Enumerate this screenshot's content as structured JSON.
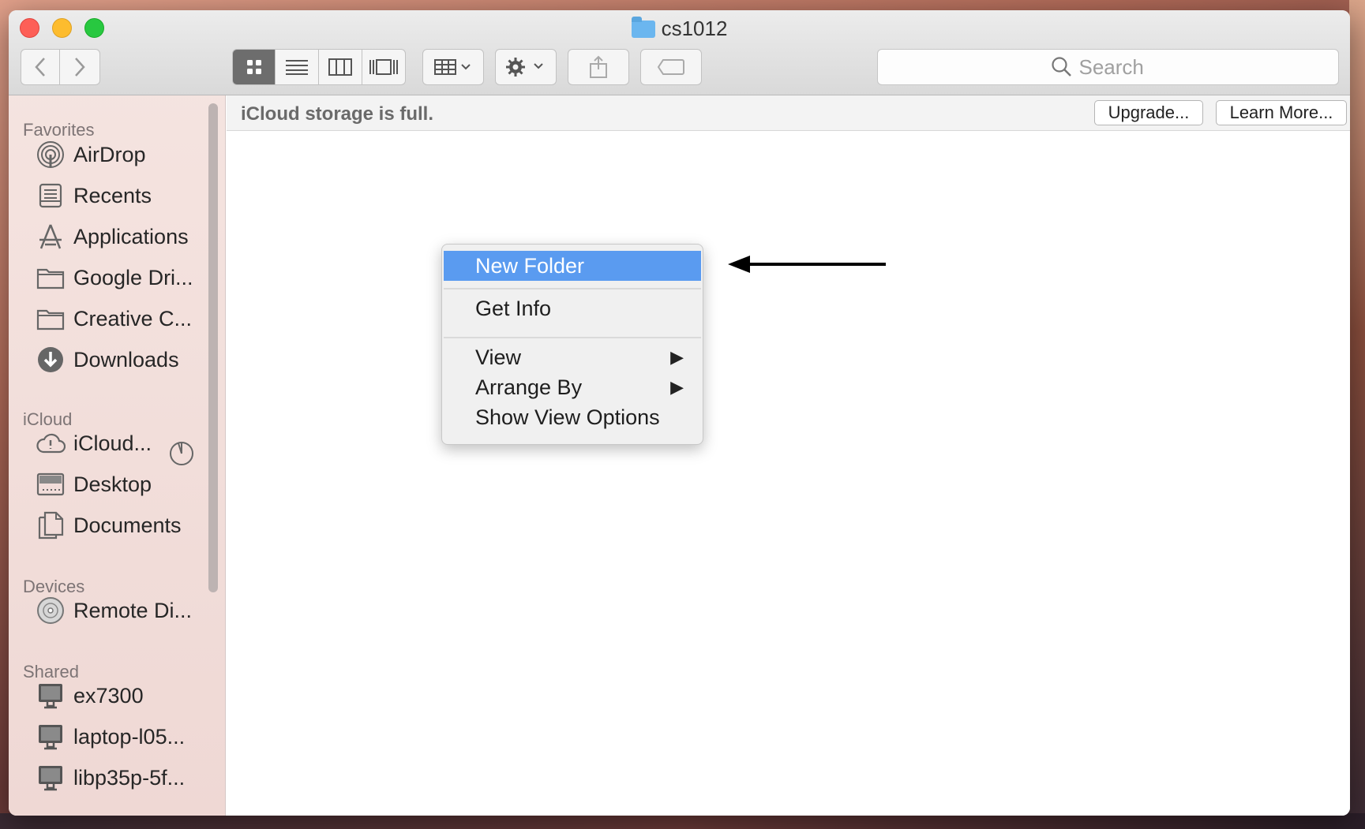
{
  "window": {
    "title": "cs1012"
  },
  "toolbar": {
    "search_placeholder": "Search"
  },
  "banner": {
    "message": "iCloud storage is full.",
    "upgrade_label": "Upgrade...",
    "learn_more_label": "Learn More..."
  },
  "sidebar": {
    "favorites_heading": "Favorites",
    "favorites": [
      {
        "label": "AirDrop",
        "icon": "airdrop-icon"
      },
      {
        "label": "Recents",
        "icon": "recents-icon"
      },
      {
        "label": "Applications",
        "icon": "applications-icon"
      },
      {
        "label": "Google Dri...",
        "icon": "folder-icon"
      },
      {
        "label": "Creative C...",
        "icon": "folder-icon"
      },
      {
        "label": "Downloads",
        "icon": "downloads-icon"
      }
    ],
    "icloud_heading": "iCloud",
    "icloud": [
      {
        "label": "iCloud...",
        "icon": "cloud-icon"
      },
      {
        "label": "Desktop",
        "icon": "desktop-icon"
      },
      {
        "label": "Documents",
        "icon": "documents-icon"
      }
    ],
    "devices_heading": "Devices",
    "devices": [
      {
        "label": "Remote Di...",
        "icon": "disc-icon"
      }
    ],
    "shared_heading": "Shared",
    "shared": [
      {
        "label": "ex7300",
        "icon": "computer-icon"
      },
      {
        "label": "laptop-l05...",
        "icon": "computer-icon"
      },
      {
        "label": "libp35p-5f...",
        "icon": "computer-icon"
      }
    ]
  },
  "context_menu": {
    "items": [
      {
        "label": "New Folder",
        "highlighted": true
      },
      {
        "label": "Get Info"
      },
      {
        "label": "View",
        "submenu": true
      },
      {
        "label": "Arrange By",
        "submenu": true
      },
      {
        "label": "Show View Options"
      }
    ]
  },
  "colors": {
    "highlight": "#5a9bf0",
    "close": "#fd5f57",
    "minimize": "#fdbc2e",
    "maximize": "#28c840"
  }
}
